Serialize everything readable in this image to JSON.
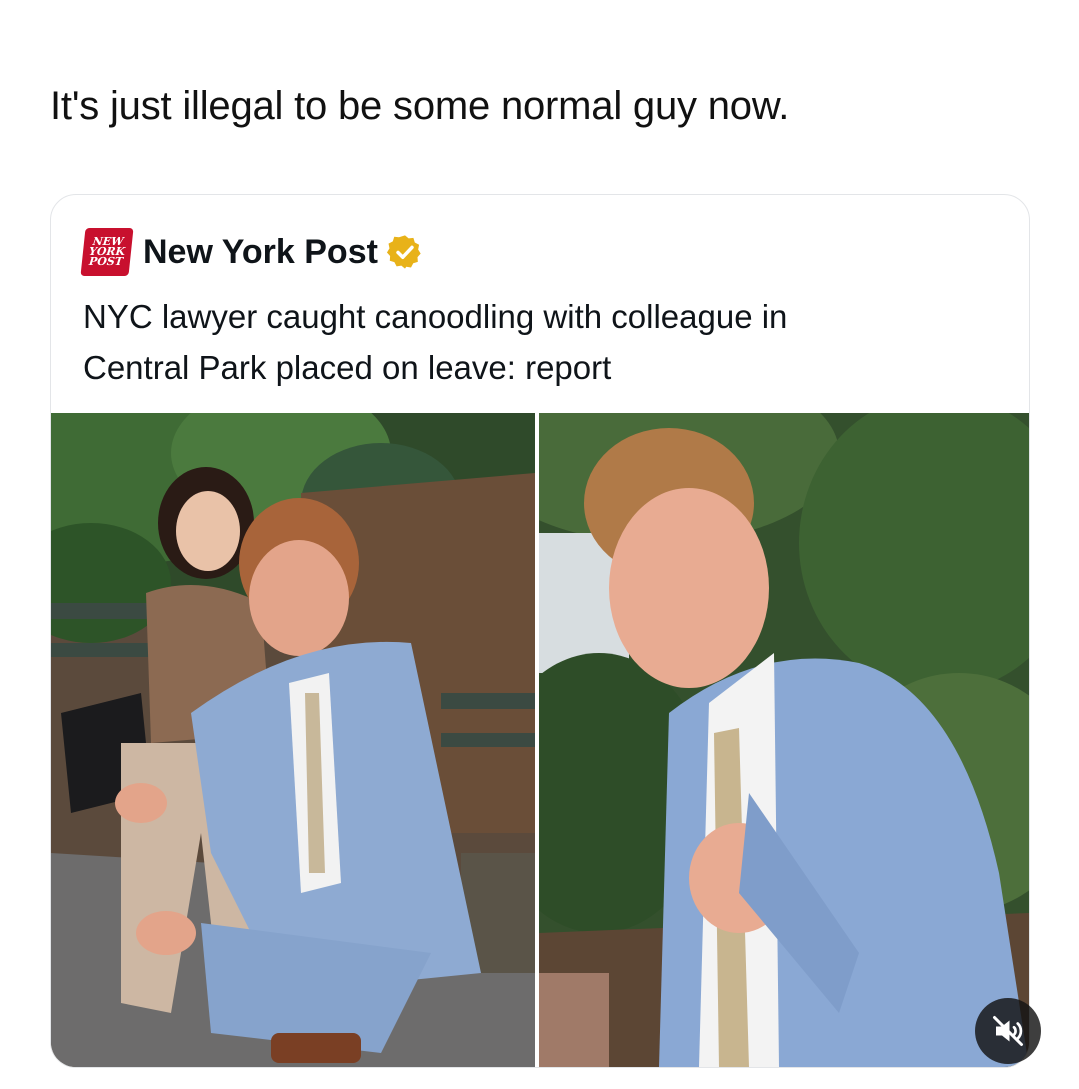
{
  "post": {
    "caption": "It's just illegal to be some normal guy now."
  },
  "embedded_tweet": {
    "logo_lines": [
      "NEW",
      "YORK",
      "POST"
    ],
    "account_name": "New York Post",
    "verified_icon": "verified-badge-icon",
    "headline_line1": "NYC lawyer caught canoodling with colleague in",
    "headline_line2": "Central Park placed on leave: report"
  },
  "media": {
    "images": [
      {
        "name": "photo-left"
      },
      {
        "name": "photo-right"
      }
    ]
  },
  "controls": {
    "mute_icon": "speaker-muted-icon"
  },
  "colors": {
    "brand_red": "#c8102e",
    "verified_gold": "#e8b219",
    "text": "#0f1419"
  }
}
